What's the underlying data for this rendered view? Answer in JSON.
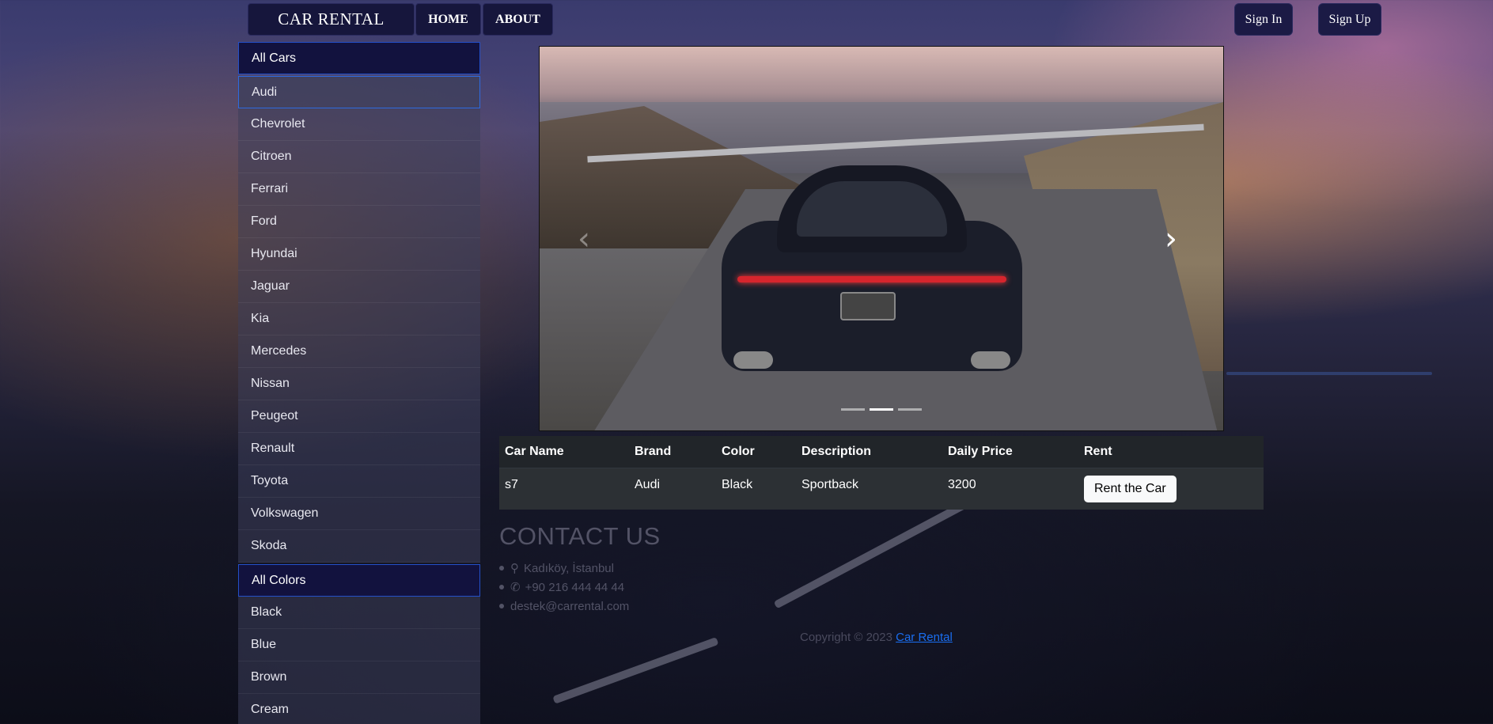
{
  "nav": {
    "brand": "CAR RENTAL",
    "home": "HOME",
    "about": "ABOUT",
    "sign_in": "Sign In",
    "sign_up": "Sign Up"
  },
  "sidebar": {
    "brands_header": "All Cars",
    "brands": [
      "Audi",
      "Chevrolet",
      "Citroen",
      "Ferrari",
      "Ford",
      "Hyundai",
      "Jaguar",
      "Kia",
      "Mercedes",
      "Nissan",
      "Peugeot",
      "Renault",
      "Toyota",
      "Volkswagen",
      "Skoda"
    ],
    "active_brand": "Audi",
    "colors_header": "All Colors",
    "colors": [
      "Black",
      "Blue",
      "Brown",
      "Cream"
    ]
  },
  "carousel": {
    "prev_icon": "chevron-left-icon",
    "next_icon": "chevron-right-icon",
    "slide_count": 3,
    "active_slide": 2
  },
  "table": {
    "headers": [
      "Car Name",
      "Brand",
      "Color",
      "Description",
      "Daily Price",
      "Rent"
    ],
    "rows": [
      {
        "car_name": "s7",
        "brand": "Audi",
        "color": "Black",
        "description": "Sportback",
        "daily_price": "3200",
        "rent_label": "Rent the Car"
      }
    ]
  },
  "contact": {
    "title": "CONTACT US",
    "address": "Kadıköy, İstanbul",
    "phone": "+90 216 444 44 44",
    "email": "destek@carrental.com"
  },
  "footer": {
    "copyright": "Copyright © 2023",
    "link": "Car Rental"
  },
  "colors": {
    "nav_bg": "#16163c",
    "active_border": "#2d6ae0",
    "link": "#1a6ef0",
    "table_bg": "#212529"
  }
}
